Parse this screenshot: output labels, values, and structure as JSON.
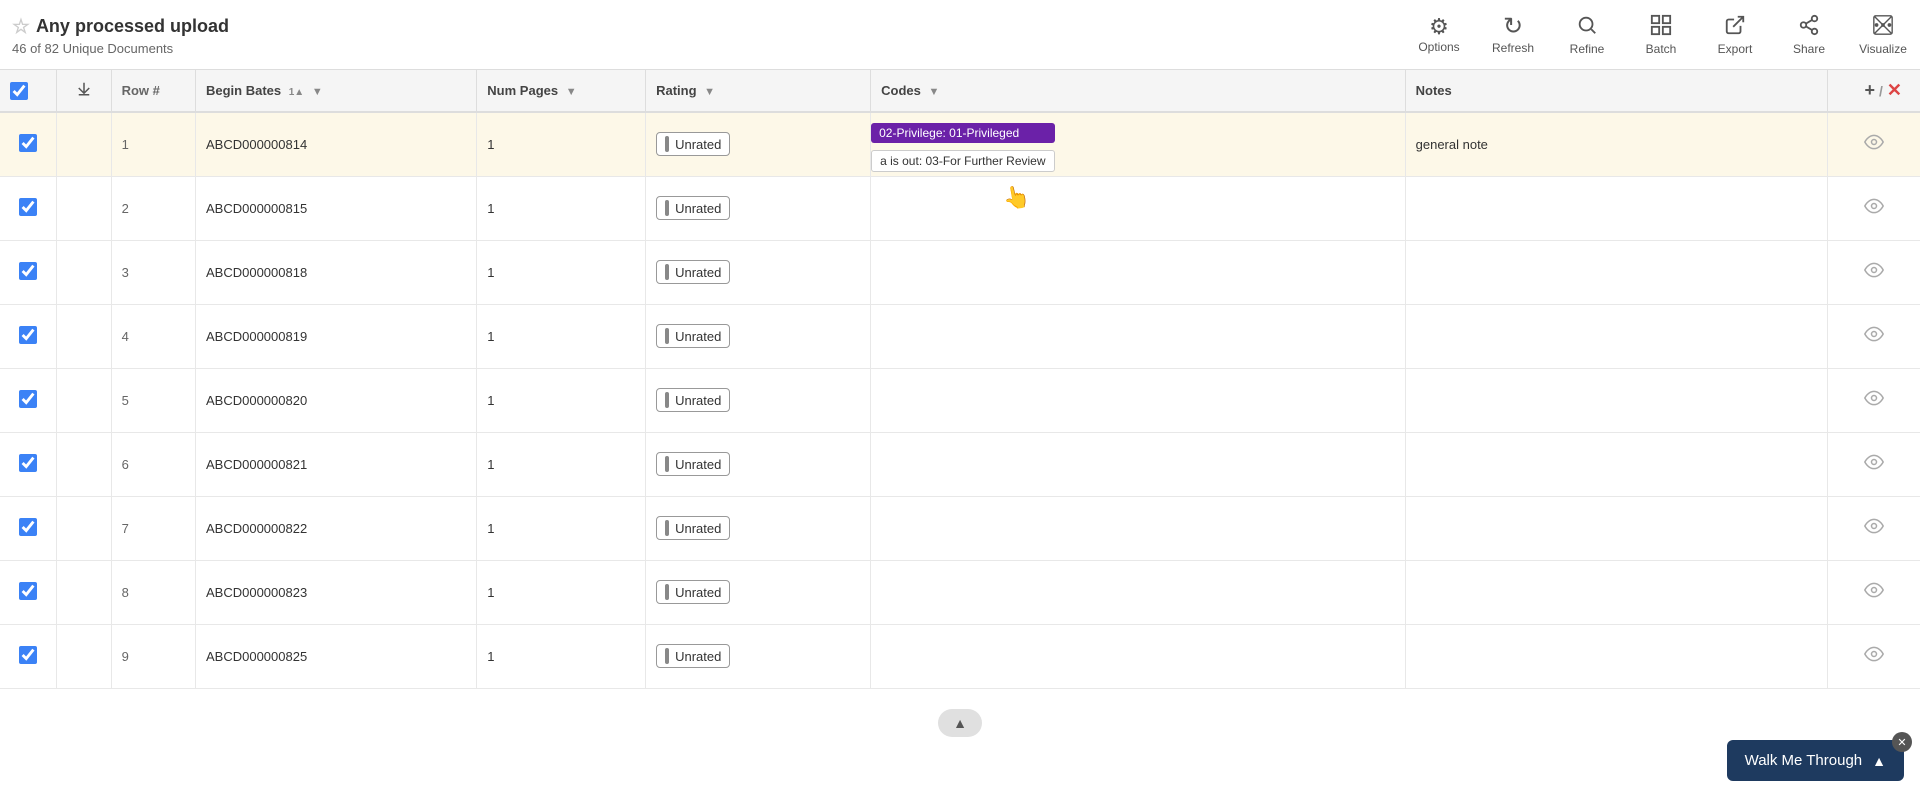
{
  "header": {
    "title": "Any processed upload",
    "subtitle": "46 of 82 Unique Documents",
    "star_icon": "☆"
  },
  "toolbar": {
    "items": [
      {
        "id": "options",
        "label": "Options",
        "icon": "⚙"
      },
      {
        "id": "refresh",
        "label": "Refresh",
        "icon": "↻"
      },
      {
        "id": "refine",
        "label": "Refine",
        "icon": "🔍"
      },
      {
        "id": "batch",
        "label": "Batch",
        "icon": "⧉"
      },
      {
        "id": "export",
        "label": "Export",
        "icon": "↗"
      },
      {
        "id": "share",
        "label": "Share",
        "icon": "⇢"
      },
      {
        "id": "visualize",
        "label": "Visualize",
        "icon": "📊"
      }
    ]
  },
  "table": {
    "columns": [
      {
        "id": "checkbox",
        "label": ""
      },
      {
        "id": "download",
        "label": ""
      },
      {
        "id": "row_num",
        "label": "Row #"
      },
      {
        "id": "begin_bates",
        "label": "Begin Bates",
        "sort": "asc",
        "sort_num": "1"
      },
      {
        "id": "num_pages",
        "label": "Num Pages",
        "filter": true
      },
      {
        "id": "rating",
        "label": "Rating",
        "filter": true
      },
      {
        "id": "codes",
        "label": "Codes",
        "filter": true
      },
      {
        "id": "notes",
        "label": "Notes"
      }
    ],
    "rows": [
      {
        "id": 1,
        "selected": true,
        "row_num": "1",
        "begin_bates": "ABCD000000814",
        "num_pages": "1",
        "rating": "Unrated",
        "codes": [
          {
            "text": "02-Privilege: 01-Privileged",
            "style": "purple"
          },
          {
            "text": "a is out: 03-For Further Review",
            "style": "outline"
          }
        ],
        "notes": "general note",
        "highlight": true
      },
      {
        "id": 2,
        "selected": true,
        "row_num": "2",
        "begin_bates": "ABCD000000815",
        "num_pages": "1",
        "rating": "Unrated",
        "codes": [],
        "notes": ""
      },
      {
        "id": 3,
        "selected": true,
        "row_num": "3",
        "begin_bates": "ABCD000000818",
        "num_pages": "1",
        "rating": "Unrated",
        "codes": [],
        "notes": ""
      },
      {
        "id": 4,
        "selected": true,
        "row_num": "4",
        "begin_bates": "ABCD000000819",
        "num_pages": "1",
        "rating": "Unrated",
        "codes": [],
        "notes": ""
      },
      {
        "id": 5,
        "selected": true,
        "row_num": "5",
        "begin_bates": "ABCD000000820",
        "num_pages": "1",
        "rating": "Unrated",
        "codes": [],
        "notes": ""
      },
      {
        "id": 6,
        "selected": true,
        "row_num": "6",
        "begin_bates": "ABCD000000821",
        "num_pages": "1",
        "rating": "Unrated",
        "codes": [],
        "notes": ""
      },
      {
        "id": 7,
        "selected": true,
        "row_num": "7",
        "begin_bates": "ABCD000000822",
        "num_pages": "1",
        "rating": "Unrated",
        "codes": [],
        "notes": ""
      },
      {
        "id": 8,
        "selected": true,
        "row_num": "8",
        "begin_bates": "ABCD000000823",
        "num_pages": "1",
        "rating": "Unrated",
        "codes": [],
        "notes": ""
      },
      {
        "id": 9,
        "selected": true,
        "row_num": "9",
        "begin_bates": "ABCD000000825",
        "num_pages": "1",
        "rating": "Unrated",
        "codes": [],
        "notes": ""
      }
    ]
  },
  "walk_me_through": {
    "label": "Walk Me Through",
    "chevron": "▲"
  },
  "scroll_up_label": "▲",
  "add_col_icon": "+",
  "remove_col_icon": "✕"
}
